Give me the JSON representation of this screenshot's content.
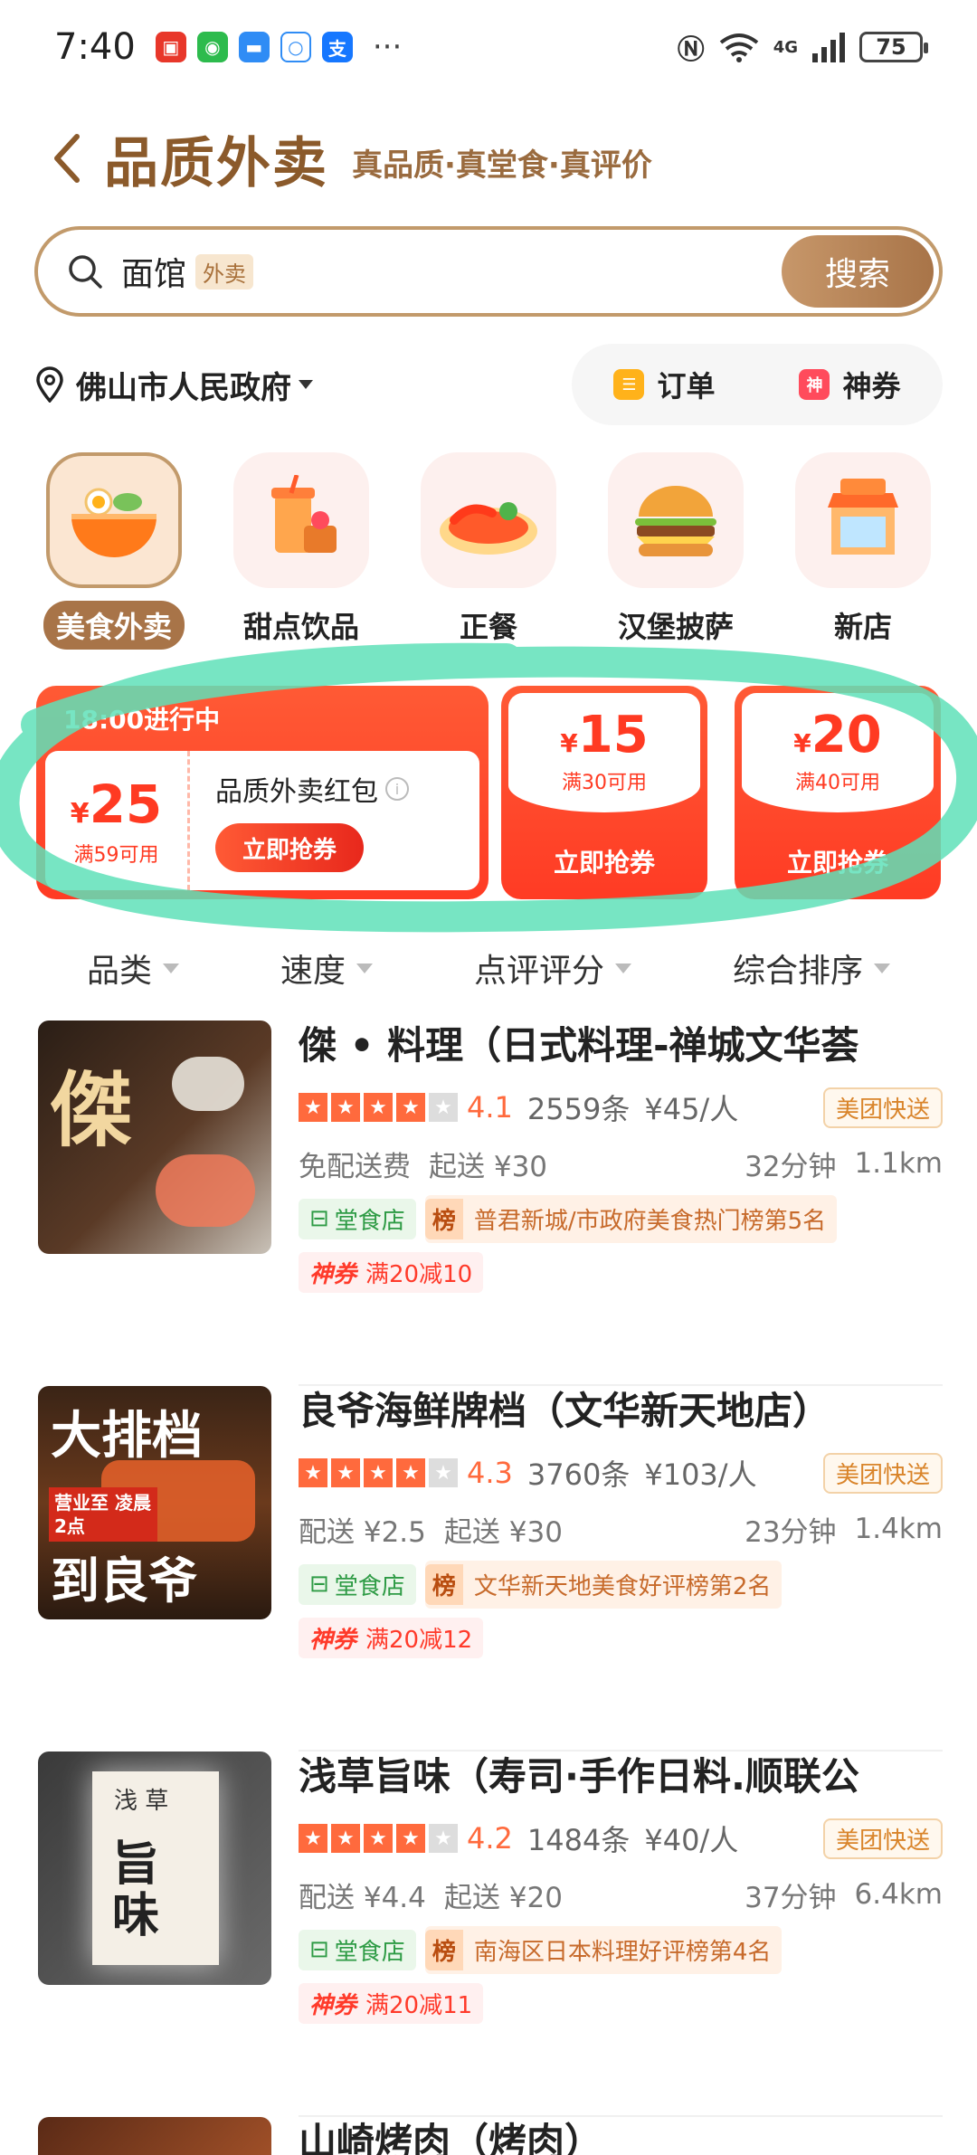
{
  "status": {
    "time": "7:40",
    "more": "···",
    "network": "4G",
    "battery": "75"
  },
  "header": {
    "title": "品质外卖",
    "subtitle": "真品质·真堂食·真评价"
  },
  "search": {
    "query": "面馆",
    "tag": "外卖",
    "button": "搜索"
  },
  "location": {
    "name": "佛山市人民政府",
    "orders_label": "订单",
    "coupons_label": "神券",
    "coupon_icon_text": "神"
  },
  "categories": [
    {
      "label": "美食外卖",
      "active": true
    },
    {
      "label": "甜点饮品",
      "active": false
    },
    {
      "label": "正餐",
      "active": false
    },
    {
      "label": "汉堡披萨",
      "active": false
    },
    {
      "label": "新店",
      "active": false
    }
  ],
  "coupons": {
    "main": {
      "status": "18:00进行中",
      "currency": "¥",
      "amount": "25",
      "condition": "满59可用",
      "name": "品质外卖红包",
      "button": "立即抢券"
    },
    "small": [
      {
        "currency": "¥",
        "amount": "15",
        "condition": "满30可用",
        "button": "立即抢券"
      },
      {
        "currency": "¥",
        "amount": "20",
        "condition": "满40可用",
        "button": "立即抢券"
      }
    ]
  },
  "filters": [
    "品类",
    "速度",
    "点评评分",
    "综合排序"
  ],
  "stores": [
    {
      "name": "傑 • 料理（日式料理-禅城文华荟",
      "rating": "4.1",
      "stars": 4,
      "reviews": "2559条",
      "price": "¥45/人",
      "badge": "美团快送",
      "delivery_fee": "免配送费",
      "min_order": "起送 ¥30",
      "time": "32分钟",
      "distance": "1.1km",
      "dine_tag": "堂食店",
      "rank_label": "榜",
      "rank": "普君新城/市政府美食热门榜第5名",
      "coupon_word": "神券",
      "coupon": "满20减10",
      "img_text": "傑"
    },
    {
      "name": "良爷海鲜牌档（文华新天地店）",
      "rating": "4.3",
      "stars": 4,
      "reviews": "3760条",
      "price": "¥103/人",
      "badge": "美团快送",
      "delivery_fee": "配送 ¥2.5",
      "min_order": "起送 ¥30",
      "time": "23分钟",
      "distance": "1.4km",
      "dine_tag": "堂食店",
      "rank_label": "榜",
      "rank": "文华新天地美食好评榜第2名",
      "coupon_word": "神券",
      "coupon": "满20减12",
      "img_text": "大排档",
      "img_text2": "营业至 凌晨2点",
      "img_text3": "到良爷"
    },
    {
      "name": "浅草旨味（寿司·手作日料.顺联公",
      "rating": "4.2",
      "stars": 4,
      "reviews": "1484条",
      "price": "¥40/人",
      "badge": "美团快送",
      "delivery_fee": "配送 ¥4.4",
      "min_order": "起送 ¥20",
      "time": "37分钟",
      "distance": "6.4km",
      "dine_tag": "堂食店",
      "rank_label": "榜",
      "rank": "南海区日本料理好评榜第4名",
      "coupon_word": "神券",
      "coupon": "满20减11",
      "img_text": "浅 草",
      "img_text2": "旨味"
    },
    {
      "name": "山崎烤肉（烤肉）"
    }
  ],
  "colors": {
    "brand_brown": "#a87448",
    "coupon_red": "#ff3a22",
    "star_orange": "#ff6a3d",
    "highlight_green": "#5fe0b8"
  }
}
